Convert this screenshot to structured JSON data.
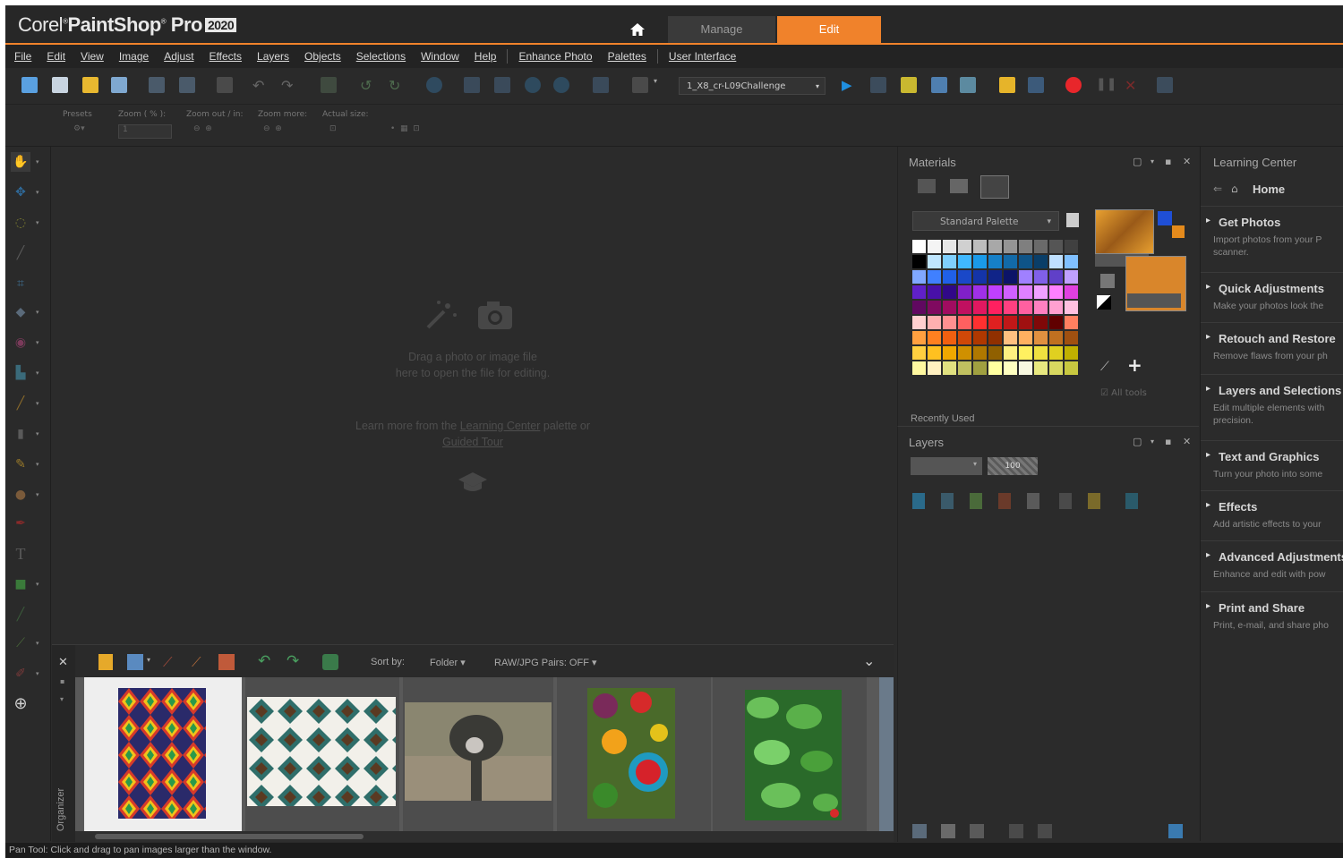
{
  "app": {
    "brand": "Corel",
    "product": "PaintShop",
    "product_suffix": "Pro",
    "year": "2020"
  },
  "mode_tabs": {
    "manage": "Manage",
    "edit": "Edit"
  },
  "menu": [
    "File",
    "Edit",
    "View",
    "Image",
    "Adjust",
    "Effects",
    "Layers",
    "Objects",
    "Selections",
    "Window",
    "Help",
    "Enhance Photo",
    "Palettes",
    "User Interface"
  ],
  "toolbar": {
    "script_name": "1_X8_cr-L09Challenge"
  },
  "tool_options": {
    "presets_label": "Presets",
    "zoom_label": "Zoom ( % ):",
    "zoom_value": "1",
    "zoom_inout_label": "Zoom out / in:",
    "zoom_more_label": "Zoom more:",
    "actual_size_label": "Actual size:"
  },
  "canvas": {
    "drop_hint_line1": "Drag a photo or image file",
    "drop_hint_line2": "here to open the file for editing.",
    "learn_prefix": "Learn more from the",
    "learn_link": "Learning Center",
    "learn_suffix": "palette or",
    "tour_link": "Guided Tour"
  },
  "organizer": {
    "side_label": "Organizer",
    "sort_label": "Sort by:",
    "sort_value": "Folder",
    "raw_label": "RAW/JPG Pairs: OFF",
    "thumbnails": [
      "tribal-pattern",
      "diamond-tiles",
      "emu",
      "vegetables",
      "green-leaves"
    ]
  },
  "materials": {
    "title": "Materials",
    "palette_select": "Standard Palette",
    "recently_used": "Recently Used",
    "all_tools": "All tools",
    "fg_color": "#d9862b",
    "bg_color": "#d9862b",
    "swatch_blue": "#1f4fd6",
    "swatch_orange": "#e48a1c"
  },
  "layers": {
    "title": "Layers",
    "opacity": "100"
  },
  "learning_center": {
    "title": "Learning Center",
    "home": "Home",
    "sections": [
      {
        "title": "Get Photos",
        "desc": "Import photos from your P scanner."
      },
      {
        "title": "Quick Adjustments",
        "desc": "Make your photos look the"
      },
      {
        "title": "Retouch and Restore",
        "desc": "Remove flaws from your ph"
      },
      {
        "title": "Layers and Selections",
        "desc": "Edit multiple elements with precision."
      },
      {
        "title": "Text and Graphics",
        "desc": "Turn your photo into some"
      },
      {
        "title": "Effects",
        "desc": "Add artistic effects to your"
      },
      {
        "title": "Advanced Adjustments",
        "desc": "Enhance and edit with pow"
      },
      {
        "title": "Print and Share",
        "desc": "Print, e-mail, and share pho"
      }
    ]
  },
  "status": {
    "text": "Pan Tool: Click and drag to pan images larger than the window."
  },
  "colors": {
    "accent": "#f0822b",
    "record": "#e8262b",
    "play": "#1f8fe0"
  }
}
